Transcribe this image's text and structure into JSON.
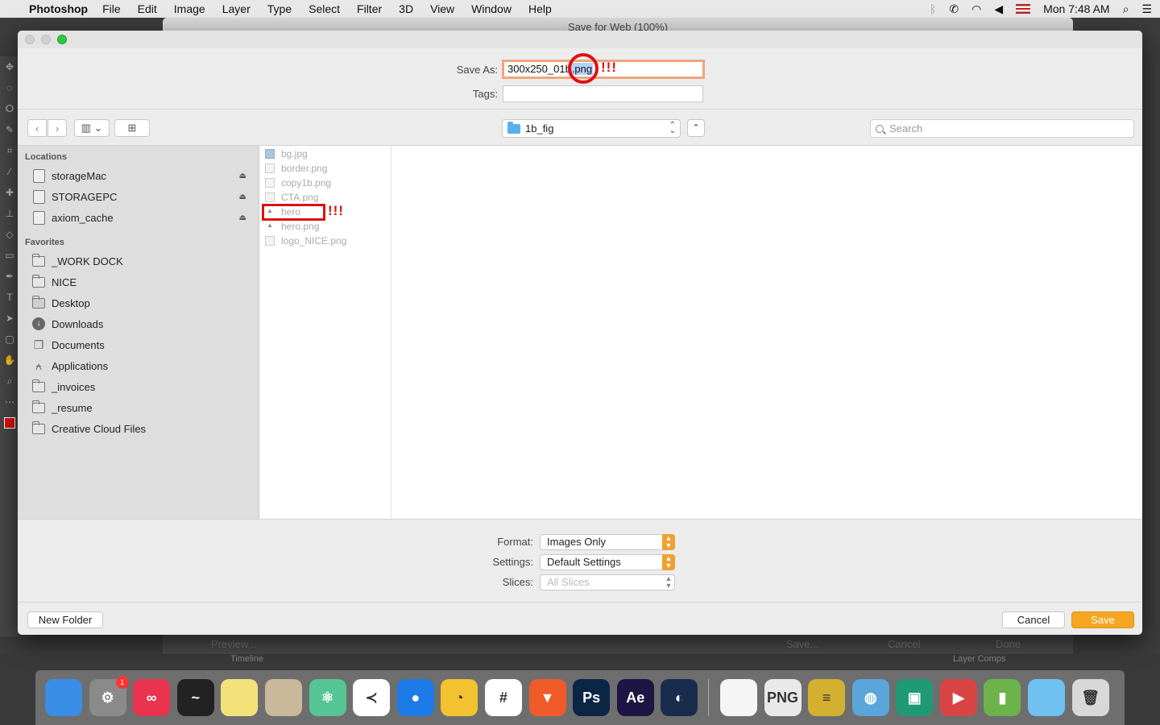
{
  "menubar": {
    "app_name": "Photoshop",
    "items": [
      "File",
      "Edit",
      "Image",
      "Layer",
      "Type",
      "Select",
      "Filter",
      "3D",
      "View",
      "Window",
      "Help"
    ],
    "clock": "Mon 7:48 AM"
  },
  "ps_window": {
    "title": "Save for Web (100%)",
    "bottom_buttons": [
      "Preview...",
      "Save...",
      "Cancel",
      "Done"
    ],
    "bottom_panels": [
      "Timeline",
      "Layer Comps"
    ]
  },
  "dialog": {
    "save_as_label": "Save As:",
    "save_as_value_prefix": "300x250_01b",
    "save_as_value_selected": ".png",
    "annotation_marks": "!!!",
    "tags_label": "Tags:",
    "tags_value": "",
    "current_folder": "1b_fig",
    "search_placeholder": "Search",
    "sidebar": {
      "locations_header": "Locations",
      "locations": [
        "storageMac",
        "STORAGEPC",
        "axiom_cache"
      ],
      "favorites_header": "Favorites",
      "favorites": [
        {
          "label": "_WORK DOCK",
          "icon": "folder-icon"
        },
        {
          "label": "NICE",
          "icon": "folder-icon"
        },
        {
          "label": "Desktop",
          "icon": "desktop-icon"
        },
        {
          "label": "Downloads",
          "icon": "downloads-icon"
        },
        {
          "label": "Documents",
          "icon": "documents-icon"
        },
        {
          "label": "Applications",
          "icon": "applications-icon"
        },
        {
          "label": "_invoices",
          "icon": "folder-icon"
        },
        {
          "label": "_resume",
          "icon": "folder-icon"
        },
        {
          "label": "Creative Cloud Files",
          "icon": "folder-icon"
        }
      ]
    },
    "files": [
      "bg.jpg",
      "border.png",
      "copy1b.png",
      "CTA.png",
      "hero",
      "hero.png",
      "logo_NICE.png"
    ],
    "format_label": "Format:",
    "format_value": "Images Only",
    "settings_label": "Settings:",
    "settings_value": "Default Settings",
    "slices_label": "Slices:",
    "slices_value": "All Slices",
    "new_folder_label": "New Folder",
    "cancel_label": "Cancel",
    "save_label": "Save"
  },
  "dock": {
    "apps": [
      {
        "name": "Finder",
        "color": "#3a8ee6",
        "glyph": ""
      },
      {
        "name": "System Preferences",
        "color": "#8a8a8a",
        "glyph": "⚙",
        "badge": "1"
      },
      {
        "name": "Creative Cloud",
        "color": "#e8344e",
        "glyph": "∞"
      },
      {
        "name": "Activity Monitor",
        "color": "#222222",
        "glyph": "~"
      },
      {
        "name": "Stickies",
        "color": "#f3e27a",
        "glyph": ""
      },
      {
        "name": "Calculator",
        "color": "#c9b89a",
        "glyph": ""
      },
      {
        "name": "Atom",
        "color": "#56c596",
        "glyph": "⚛"
      },
      {
        "name": "VS Code",
        "color": "#ffffff",
        "glyph": "≺"
      },
      {
        "name": "Maps Pin",
        "color": "#1c7be6",
        "glyph": "●"
      },
      {
        "name": "Chrome",
        "color": "#f2c230",
        "glyph": "◔"
      },
      {
        "name": "Slack",
        "color": "#ffffff",
        "glyph": "#"
      },
      {
        "name": "Brave",
        "color": "#f05a28",
        "glyph": "▼"
      },
      {
        "name": "Photoshop",
        "color": "#0b2545",
        "glyph": "Ps"
      },
      {
        "name": "After Effects",
        "color": "#1d1544",
        "glyph": "Ae"
      },
      {
        "name": "Cinema 4D",
        "color": "#1a2c4e",
        "glyph": "◐"
      },
      {
        "name": "Blank Document",
        "color": "#f5f5f5",
        "glyph": ""
      },
      {
        "name": "PNG Preview",
        "color": "#e9e9e9",
        "glyph": "PNG"
      },
      {
        "name": "Archive",
        "color": "#d4b030",
        "glyph": "≡"
      },
      {
        "name": "Web Folder",
        "color": "#5aa6da",
        "glyph": "◍"
      },
      {
        "name": "Green Folder",
        "color": "#1f9a74",
        "glyph": "▣"
      },
      {
        "name": "Red Folder",
        "color": "#d94545",
        "glyph": "▶"
      },
      {
        "name": "Green Folder 2",
        "color": "#6cb34a",
        "glyph": "▮"
      },
      {
        "name": "Blue Folder",
        "color": "#6ec1f1",
        "glyph": ""
      },
      {
        "name": "Trash",
        "color": "#d8d8d8",
        "glyph": "🗑"
      }
    ]
  }
}
